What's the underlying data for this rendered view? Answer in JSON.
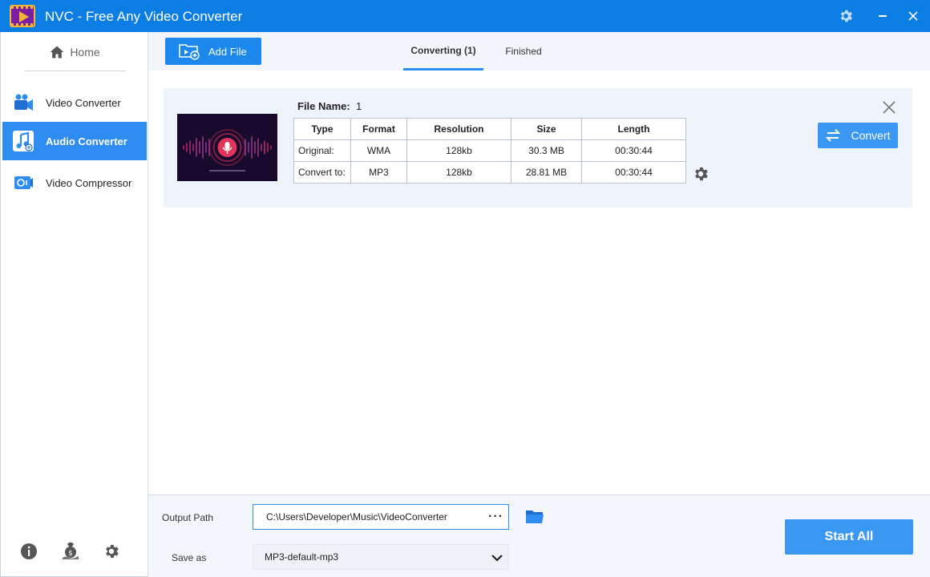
{
  "window": {
    "title": "NVC - Free Any Video Converter"
  },
  "sidebar": {
    "home_label": "Home",
    "items": [
      {
        "label": "Video Converter",
        "icon": "video-camera-icon"
      },
      {
        "label": "Audio Converter",
        "icon": "music-note-icon",
        "active": true
      },
      {
        "label": "Video Compressor",
        "icon": "compress-icon"
      }
    ],
    "bottom_icons": [
      "info-icon",
      "donate-icon",
      "settings-icon"
    ]
  },
  "toolbar": {
    "add_file_label": "Add File",
    "tabs": [
      {
        "label": "Converting (1)",
        "active": true
      },
      {
        "label": "Finished",
        "active": false
      }
    ]
  },
  "file": {
    "name_label": "File Name:",
    "name_value": "1",
    "table": {
      "headers": [
        "Type",
        "Format",
        "Resolution",
        "Size",
        "Length"
      ],
      "rows": [
        [
          "Original:",
          "WMA",
          "128kb",
          "30.3 MB",
          "00:30:44"
        ],
        [
          "Convert to:",
          "MP3",
          "128kb",
          "28.81 MB",
          "00:30:44"
        ]
      ]
    },
    "convert_label": "Convert"
  },
  "bottom": {
    "output_path_label": "Output Path",
    "output_path_value": "C:\\Users\\Developer\\Music\\VideoConverter",
    "output_path_dots": "···",
    "save_as_label": "Save as",
    "save_as_value": "MP3-default-mp3",
    "start_all_label": "Start All"
  },
  "colors": {
    "title_bar": "#0b7de3",
    "accent": "#2f8cf0",
    "button": "#3b98f2"
  }
}
